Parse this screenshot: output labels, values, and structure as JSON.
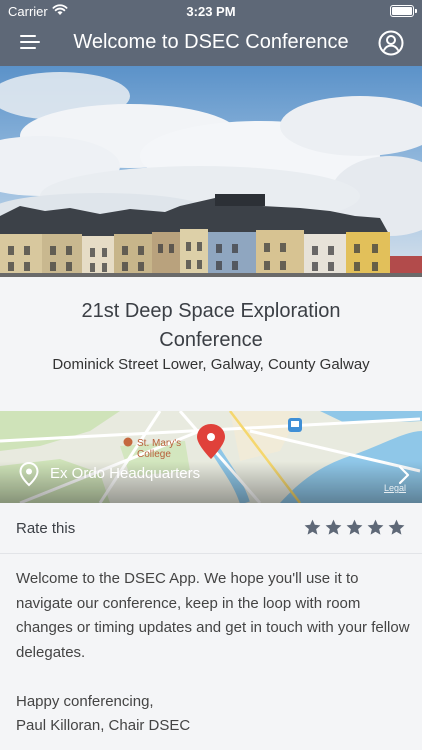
{
  "status_bar": {
    "carrier": "Carrier",
    "time": "3:23 PM"
  },
  "nav": {
    "title": "Welcome to DSEC Conference",
    "menu_icon": "hamburger-menu-icon",
    "profile_icon": "user-circle-icon"
  },
  "event": {
    "title": "21st Deep Space Exploration Conference",
    "address": "Dominick Street Lower, Galway, County Galway"
  },
  "map": {
    "location_label": "Ex Ordo Headquarters",
    "poi_label": "St. Mary's College",
    "legal": "Legal",
    "pin_icon": "location-pin-icon",
    "chevron_icon": "chevron-right-icon"
  },
  "rating": {
    "label": "Rate this",
    "max_stars": 5,
    "value": 5
  },
  "welcome": {
    "paragraph1": "Welcome to the DSEC App. We hope you'll use it to navigate our conference, keep in the loop with room changes or timing updates and get in touch with your fellow delegates.",
    "sign_off_line1": "Happy conferencing,",
    "sign_off_line2": "Paul Killoran, Chair DSEC"
  },
  "colors": {
    "nav_bar": "#5e6877",
    "star": "#5e6877",
    "background": "#f4f5f7",
    "map_pin": "#e0413a"
  }
}
